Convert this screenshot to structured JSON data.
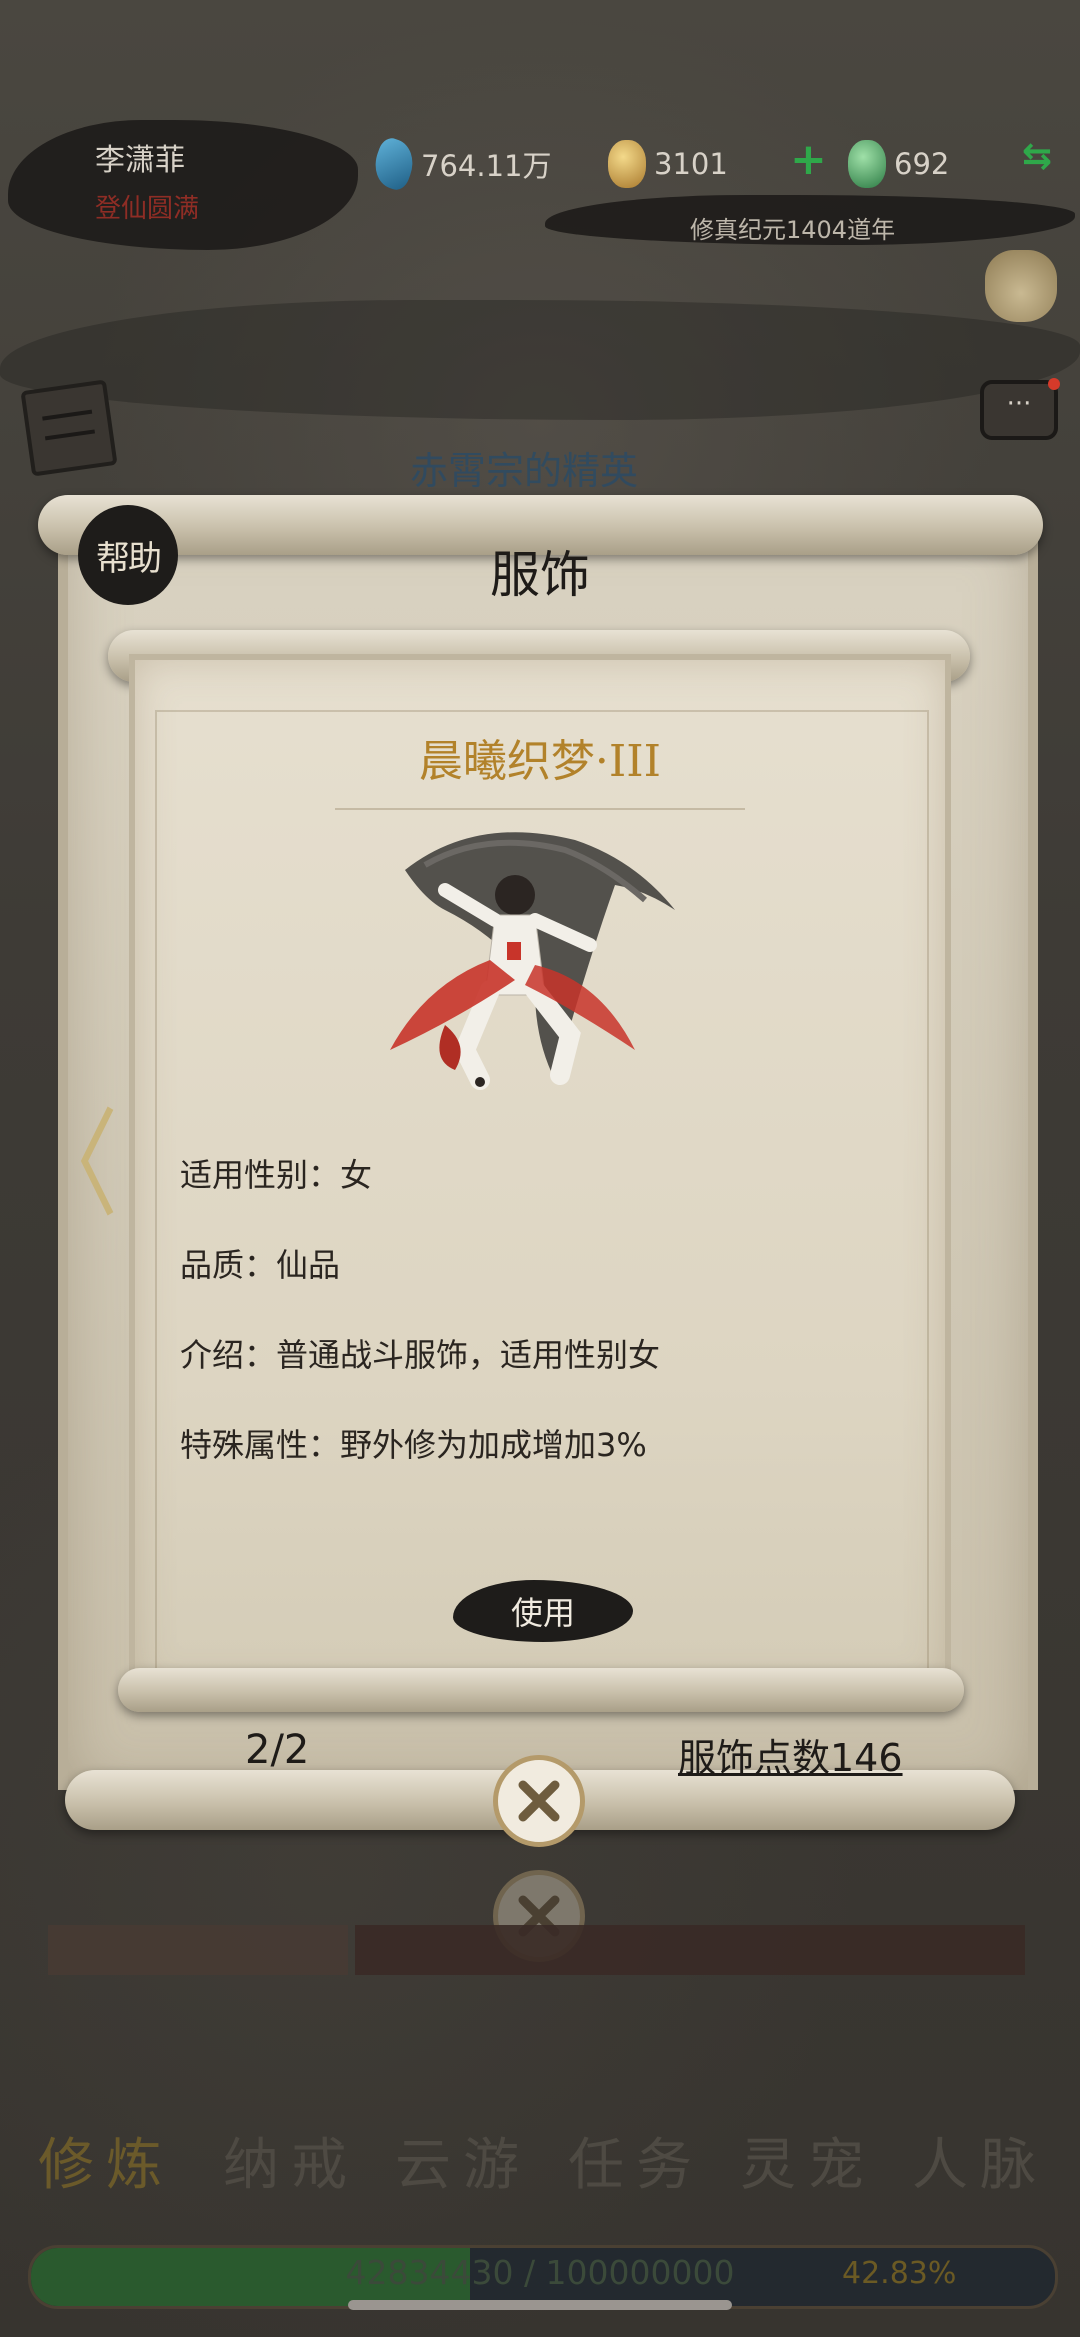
{
  "header": {
    "player_name": "李潇菲",
    "player_rank": "登仙圆满",
    "crystal_amount": "764.11万",
    "gold_amount": "3101",
    "jade_amount": "692",
    "plus_label": "+",
    "swap_label": "⇆",
    "era": "修真纪元1404道年",
    "chat_label": "···"
  },
  "background": {
    "faint_title": "赤霄宗的精英"
  },
  "panel": {
    "help_label": "帮助",
    "title": "服饰",
    "item": {
      "name": "晨曦织梦·III",
      "attributes": [
        {
          "text": "适用性别：女"
        },
        {
          "text": "品质：仙品"
        },
        {
          "text": "介绍：普通战斗服饰，适用性别女"
        },
        {
          "text": "特殊属性：野外修为加成增加3%"
        }
      ],
      "use_label": "使用"
    },
    "page_indicator": "2/2",
    "points_label": "服饰点数146",
    "nav_prev": "〈"
  },
  "bottom_nav": {
    "tabs": [
      {
        "label": "修炼",
        "active": true
      },
      {
        "label": "纳戒"
      },
      {
        "label": "云游"
      },
      {
        "label": "任务"
      },
      {
        "label": "灵宠"
      },
      {
        "label": "人脉"
      }
    ]
  },
  "progress": {
    "text": "42834430 / 100000000",
    "percent_label": "42.83%",
    "fraction": 0.4283
  },
  "colors": {
    "accent_gold": "#b2822a",
    "rank_red": "#8f2d25",
    "plus_green": "#2fa84a"
  }
}
